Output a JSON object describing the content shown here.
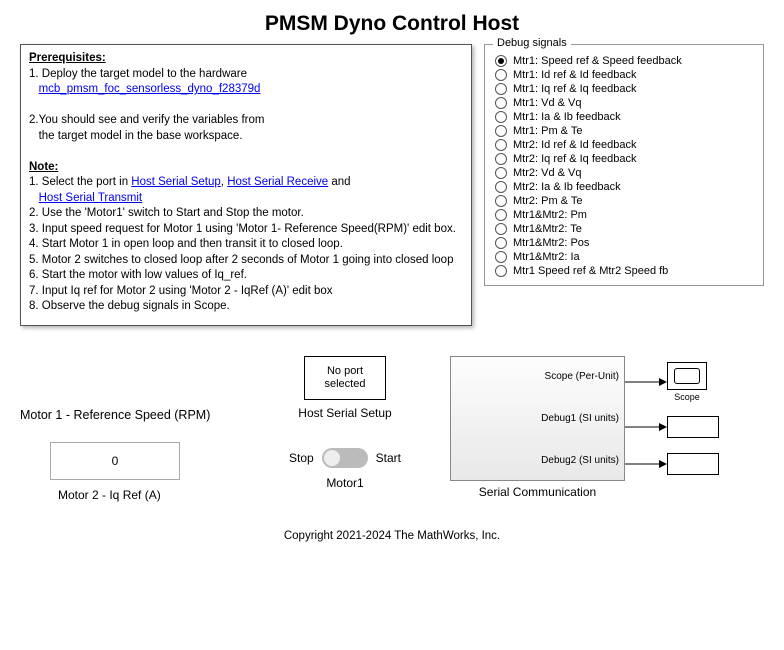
{
  "title": "PMSM Dyno Control Host",
  "prereq": {
    "hdr1": "Prerequisites:",
    "line1": "1. Deploy the target model to the hardware",
    "link1": "mcb_pmsm_foc_sensorless_dyno_f28379d",
    "line2a": "2.You should see and verify the variables from",
    "line2b": "   the target model in the base workspace.",
    "hdr2": "Note:",
    "n1a": "1. Select the port in ",
    "n1l1": "Host Serial Setup",
    "n1b": ", ",
    "n1l2": "Host Serial Receive",
    "n1c": " and",
    "n1l3": "Host Serial Transmit",
    "n2": "2. Use the 'Motor1' switch to Start and Stop the motor.",
    "n3": "3. Input speed request for Motor 1 using 'Motor 1- Reference Speed(RPM)' edit box.",
    "n4": "4. Start Motor 1 in open loop and then transit it to closed loop.",
    "n5": "5. Motor 2 switches to closed loop after 2 seconds of Motor 1 going into closed loop",
    "n6": "6. Start the motor with low values of Iq_ref.",
    "n7": "7. Input Iq ref for Motor 2 using 'Motor 2 - IqRef (A)' edit box",
    "n8": "8. Observe the debug signals in Scope."
  },
  "debug": {
    "legend": "Debug signals",
    "selected_index": 0,
    "items": [
      "Mtr1: Speed ref & Speed feedback",
      "Mtr1: Id ref & Id feedback",
      "Mtr1: Iq ref & Iq feedback",
      "Mtr1: Vd & Vq",
      "Mtr1: Ia & Ib feedback",
      "Mtr1: Pm & Te",
      "Mtr2: Id ref & Id feedback",
      "Mtr2: Iq ref & Iq feedback",
      "Mtr2: Vd & Vq",
      "Mtr2: Ia & Ib feedback",
      "Mtr2: Pm & Te",
      "Mtr1&Mtr2: Pm",
      "Mtr1&Mtr2: Te",
      "Mtr1&Mtr2: Pos",
      "Mtr1&Mtr2: Ia",
      "Mtr1 Speed ref & Mtr2 Speed fb"
    ]
  },
  "noport": "No port selected",
  "host_serial_label": "Host Serial Setup",
  "m1_label": "Motor 1 - Reference Speed (RPM)",
  "m1_value": "0",
  "m2_label": "Motor 2 - Iq Ref (A)",
  "stop": "Stop",
  "start": "Start",
  "motor1_lbl": "Motor1",
  "serial": {
    "p1": "Scope (Per-Unit)",
    "p2": "Debug1 (SI units)",
    "p3": "Debug2 (SI units)",
    "title": "Serial Communication",
    "scope_lbl": "Scope"
  },
  "copyright": "Copyright 2021-2024 The MathWorks, Inc."
}
